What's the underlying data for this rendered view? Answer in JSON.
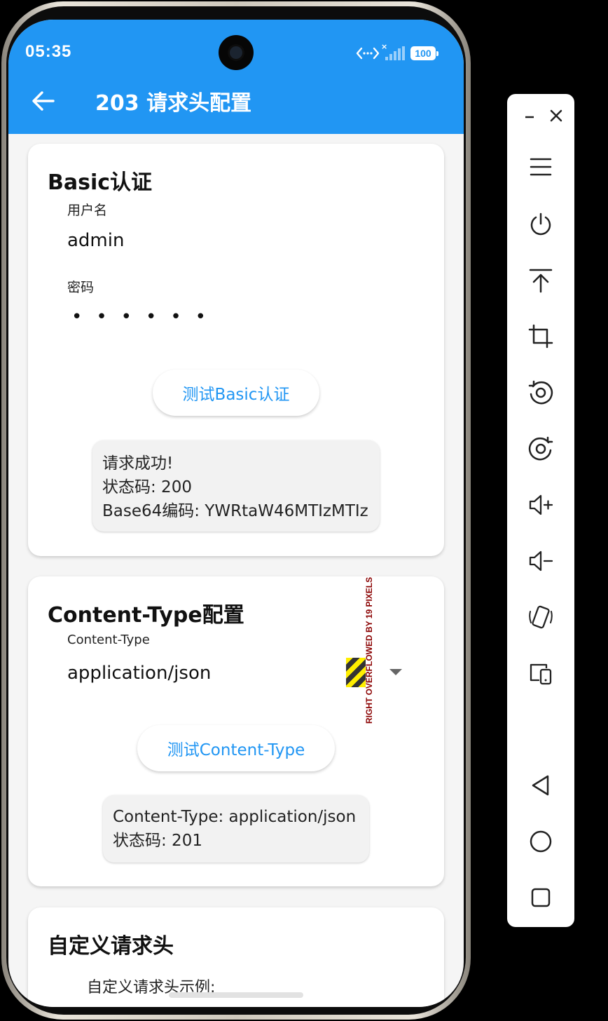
{
  "status_bar": {
    "time": "05:35",
    "signal_x": "×",
    "battery": "100"
  },
  "app_bar": {
    "title": "203 请求头配置"
  },
  "basic_auth": {
    "title": "Basic认证",
    "username_label": "用户名",
    "username_value": "admin",
    "password_label": "密码",
    "password_mask": "••••••",
    "test_button": "测试Basic认证",
    "result_lines": [
      "请求成功!",
      "状态码: 200",
      "Base64编码: YWRtaW46MTIzMTIz"
    ]
  },
  "content_type": {
    "title": "Content-Type配置",
    "field_label": "Content-Type",
    "selected_value": "application/json",
    "overflow_warning": "RIGHT OVERFLOWED BY 19 PIXELS",
    "test_button": "测试Content-Type",
    "result_lines": [
      "Content-Type: application/json",
      "状态码: 201"
    ]
  },
  "custom_headers": {
    "title": "自定义请求头",
    "example_label": "自定义请求头示例:"
  },
  "toolbar": {
    "icons": [
      "minimize-icon",
      "close-icon",
      "menu-icon",
      "power-icon",
      "pin-top-icon",
      "crop-icon",
      "rotate-left-icon",
      "rotate-right-icon",
      "volume-up-icon",
      "volume-down-icon",
      "shake-icon",
      "multi-device-icon",
      "back-nav-icon",
      "home-nav-icon",
      "recents-nav-icon"
    ]
  },
  "colors": {
    "primary": "#2196f3",
    "card": "#ffffff",
    "background": "#f5f5f5"
  }
}
